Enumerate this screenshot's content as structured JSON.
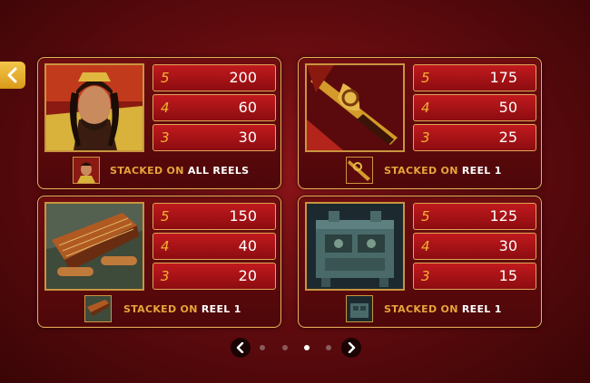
{
  "topbar": {
    "text": ""
  },
  "panels": [
    {
      "symbol": "warrior-symbol",
      "rows": [
        {
          "count": "5",
          "pay": "200"
        },
        {
          "count": "4",
          "pay": "60"
        },
        {
          "count": "3",
          "pay": "30"
        }
      ],
      "stacked_label": "STACKED ON",
      "stacked_where": "ALL REELS"
    },
    {
      "symbol": "sword-symbol",
      "rows": [
        {
          "count": "5",
          "pay": "175"
        },
        {
          "count": "4",
          "pay": "50"
        },
        {
          "count": "3",
          "pay": "25"
        }
      ],
      "stacked_label": "STACKED ON",
      "stacked_where": "REEL 1"
    },
    {
      "symbol": "instrument-symbol",
      "rows": [
        {
          "count": "5",
          "pay": "150"
        },
        {
          "count": "4",
          "pay": "40"
        },
        {
          "count": "3",
          "pay": "20"
        }
      ],
      "stacked_label": "STACKED ON",
      "stacked_where": "REEL 1"
    },
    {
      "symbol": "bronze-vessel-symbol",
      "rows": [
        {
          "count": "5",
          "pay": "125"
        },
        {
          "count": "4",
          "pay": "30"
        },
        {
          "count": "3",
          "pay": "15"
        }
      ],
      "stacked_label": "STACKED ON",
      "stacked_where": "REEL 1"
    }
  ],
  "pagination": {
    "page": 3,
    "total": 4
  },
  "colors": {
    "accent": "#e7a43a",
    "panel_border": "#e4b35a",
    "row": "#c11a1d"
  }
}
